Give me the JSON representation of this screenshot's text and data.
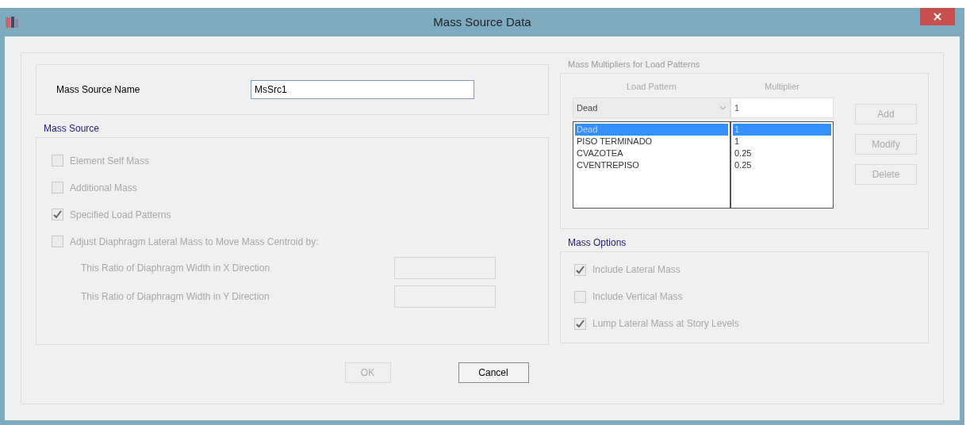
{
  "window": {
    "title": "Mass Source Data"
  },
  "name_field": {
    "label": "Mass Source Name",
    "value": "MsSrc1"
  },
  "mass_source": {
    "title": "Mass Source",
    "options": [
      {
        "label": "Element Self Mass",
        "checked": false,
        "disabled": true
      },
      {
        "label": "Additional Mass",
        "checked": false,
        "disabled": true
      },
      {
        "label": "Specified Load Patterns",
        "checked": true,
        "disabled": true
      },
      {
        "label": "Adjust Diaphragm Lateral Mass to Move Mass Centroid by:",
        "checked": false,
        "disabled": true
      }
    ],
    "ratios": [
      {
        "label": "This Ratio of Diaphragm Width in X Direction",
        "disabled": true
      },
      {
        "label": "This Ratio of Diaphragm Width in Y Direction",
        "disabled": true
      }
    ]
  },
  "multipliers": {
    "title": "Mass Multipliers for Load Patterns",
    "column_headers": [
      "Load Pattern",
      "Multiplier"
    ],
    "pattern_select": "Dead",
    "multiplier_value": "1",
    "rows": [
      {
        "pattern": "Dead",
        "multiplier": "1",
        "selected": true
      },
      {
        "pattern": "PISO TERMINADO",
        "multiplier": "1",
        "selected": false
      },
      {
        "pattern": "CVAZOTEA",
        "multiplier": "0.25",
        "selected": false
      },
      {
        "pattern": "CVENTREPISO",
        "multiplier": "0.25",
        "selected": false
      }
    ],
    "buttons": [
      {
        "label": "Add",
        "disabled": true
      },
      {
        "label": "Modify",
        "disabled": true
      },
      {
        "label": "Delete",
        "disabled": true
      }
    ]
  },
  "mass_options": {
    "title": "Mass Options",
    "options": [
      {
        "label": "Include Lateral Mass",
        "checked": true,
        "disabled": true
      },
      {
        "label": "Include Vertical Mass",
        "checked": false,
        "disabled": true
      },
      {
        "label": "Lump Lateral Mass at Story Levels",
        "checked": true,
        "disabled": true
      }
    ]
  },
  "footer_buttons": [
    {
      "label": "OK",
      "disabled": true
    },
    {
      "label": "Cancel",
      "disabled": false
    }
  ]
}
